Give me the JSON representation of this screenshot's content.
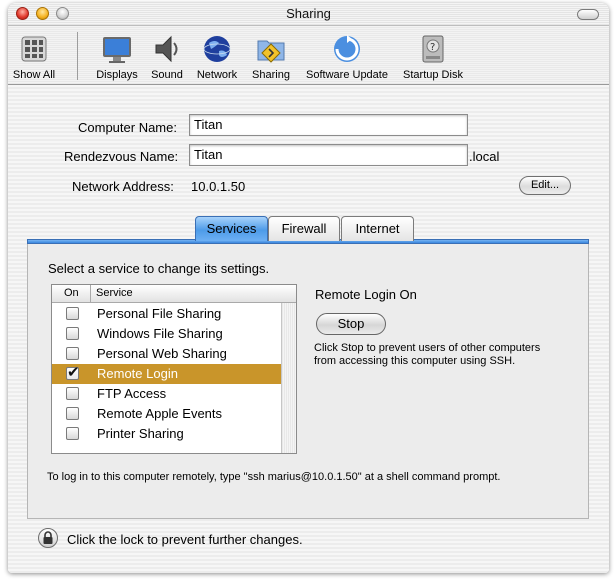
{
  "window": {
    "title": "Sharing"
  },
  "toolbar": {
    "items": [
      {
        "label": "Show All",
        "icon": "show-all-icon"
      },
      {
        "label": "Displays",
        "icon": "displays-icon"
      },
      {
        "label": "Sound",
        "icon": "sound-icon"
      },
      {
        "label": "Network",
        "icon": "network-globe-icon"
      },
      {
        "label": "Sharing",
        "icon": "sharing-folder-icon"
      },
      {
        "label": "Software Update",
        "icon": "software-update-icon"
      },
      {
        "label": "Startup Disk",
        "icon": "startup-disk-icon"
      }
    ]
  },
  "form": {
    "computer_name_label": "Computer Name:",
    "computer_name_value": "Titan",
    "rendezvous_name_label": "Rendezvous Name:",
    "rendezvous_name_value": "Titan",
    "rendezvous_suffix": ".local",
    "network_address_label": "Network Address:",
    "network_address_value": "10.0.1.50",
    "edit_label": "Edit..."
  },
  "tabs": [
    {
      "label": "Services",
      "active": true
    },
    {
      "label": "Firewall",
      "active": false
    },
    {
      "label": "Internet",
      "active": false
    }
  ],
  "services": {
    "instruction": "Select a service to change its settings.",
    "column_on": "On",
    "column_service": "Service",
    "items": [
      {
        "label": "Personal File Sharing",
        "checked": false,
        "selected": false
      },
      {
        "label": "Windows File Sharing",
        "checked": false,
        "selected": false
      },
      {
        "label": "Personal Web Sharing",
        "checked": false,
        "selected": false
      },
      {
        "label": "Remote Login",
        "checked": true,
        "selected": true
      },
      {
        "label": "FTP Access",
        "checked": false,
        "selected": false
      },
      {
        "label": "Remote Apple Events",
        "checked": false,
        "selected": false
      },
      {
        "label": "Printer Sharing",
        "checked": false,
        "selected": false
      }
    ],
    "status_title": "Remote Login On",
    "stop_label": "Stop",
    "description": "Click Stop to prevent users of other computers from accessing this computer using SSH.",
    "note": "To log in to this computer remotely, type \"ssh marius@10.0.1.50\" at a shell command prompt."
  },
  "footer": {
    "lock_text": "Click the lock to prevent further changes."
  },
  "colors": {
    "selection": "#c9952a",
    "tab_active": "#4d9be8"
  }
}
